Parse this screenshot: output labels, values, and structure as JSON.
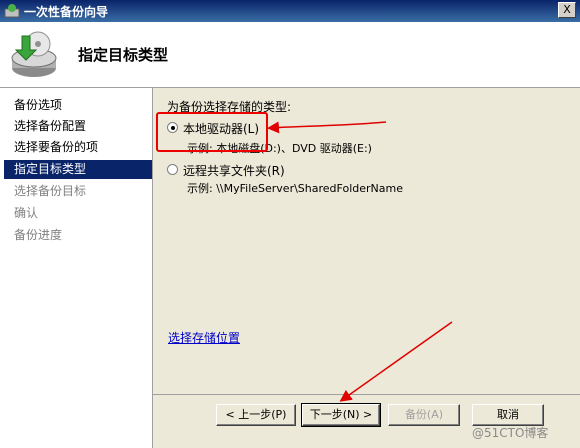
{
  "window": {
    "title": "一次性备份向导",
    "close_glyph": "X"
  },
  "header": {
    "title": "指定目标类型"
  },
  "sidebar": {
    "items": [
      {
        "label": "备份选项",
        "state": "done"
      },
      {
        "label": "选择备份配置",
        "state": "done"
      },
      {
        "label": "选择要备份的项",
        "state": "done"
      },
      {
        "label": "指定目标类型",
        "state": "active"
      },
      {
        "label": "选择备份目标",
        "state": "pending"
      },
      {
        "label": "确认",
        "state": "pending"
      },
      {
        "label": "备份进度",
        "state": "pending"
      }
    ]
  },
  "main": {
    "prompt": "为备份选择存储的类型:",
    "options": [
      {
        "label": "本地驱动器(L)",
        "example": "示例: 本地磁盘(D:)、DVD 驱动器(E:)",
        "selected": true
      },
      {
        "label": "远程共享文件夹(R)",
        "example": "示例: \\\\MyFileServer\\SharedFolderName",
        "selected": false
      }
    ],
    "link": "选择存储位置"
  },
  "buttons": {
    "back": "< 上一步(P)",
    "next": "下一步(N) >",
    "backup": "备份(A)",
    "cancel": "取消"
  },
  "watermark": "@51CTO博客",
  "colors": {
    "accent": "#0a246a",
    "annotation": "#e00000",
    "link": "#0000cc"
  }
}
